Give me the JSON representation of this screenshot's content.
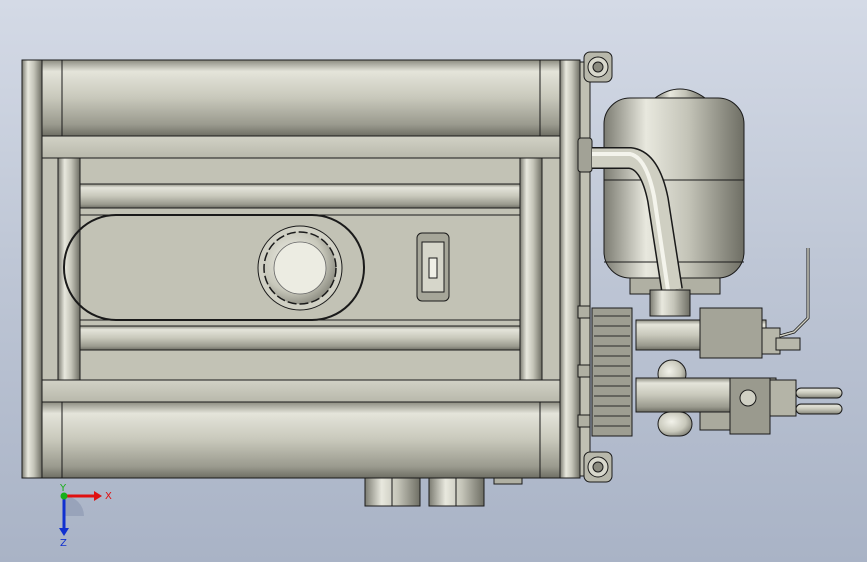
{
  "viewport": {
    "background_top": "#d4dae6",
    "background_bottom": "#a9b3c6"
  },
  "model": {
    "body_color": "#c9c9bc",
    "shade_color": "#8f8f84",
    "edge_color": "#1a1a1a"
  },
  "triad": {
    "x_label": "X",
    "y_label": "Y",
    "z_label": "Z",
    "x_color": "#e01010",
    "y_color": "#18b018",
    "z_color": "#1030d0"
  }
}
